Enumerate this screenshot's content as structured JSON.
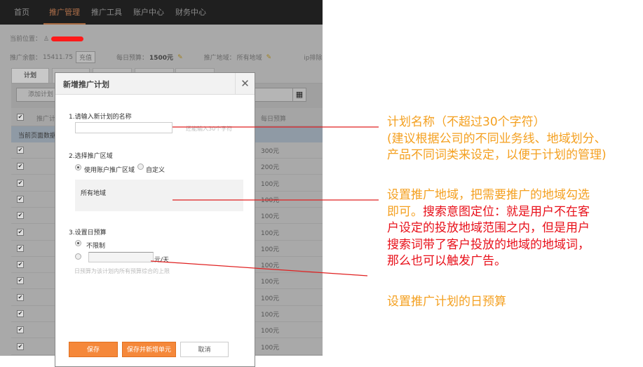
{
  "nav": {
    "items": [
      "首页",
      "推广管理",
      "推广工具",
      "账户中心",
      "财务中心"
    ],
    "active": 1
  },
  "location": {
    "label": "当前位置："
  },
  "summary": {
    "balance_label": "推广余额：",
    "balance": "15411.75",
    "recharge": "充值",
    "daily_label": "每日预算：",
    "daily": "1500元",
    "region_label": "推广地域：",
    "region": "所有地域",
    "ip_exclude": "ip排除"
  },
  "tabs": {
    "first": "计划"
  },
  "toolbar": {
    "add_plan": "添加计划"
  },
  "table": {
    "header_plan": "推广计",
    "header_budget": "每日预算",
    "page_data_label": "当前页面数据",
    "budgets": [
      "300元",
      "200元",
      "100元",
      "100元",
      "100元",
      "100元",
      "100元",
      "100元",
      "100元",
      "100元",
      "100元",
      "100元",
      "100元"
    ]
  },
  "modal": {
    "title": "新增推广计划",
    "step1": "1.请输入新计划的名称",
    "name_value": "",
    "name_hint": "还能输入30个字符",
    "step2": "2.选择推广区域",
    "use_account_region": "使用账户推广区域",
    "custom": "自定义",
    "region_box": "所有地域",
    "step3": "3.设置日预算",
    "unlimited": "不限制",
    "budget_value": "",
    "per_day": "元/天",
    "budget_hint": "日预算为该计划内所有预算综合的上限",
    "save": "保存",
    "save_and_add": "保存并新增单元",
    "cancel": "取消"
  },
  "annotations": {
    "a1": [
      "计划名称（不超过30个字符）",
      "(建议根据公司的不同业务线、地域划分、",
      "产品不同词类来设定，以便于计划的管理)"
    ],
    "a2_orange": [
      "设置推广地域，把需要推广的地域勾选",
      "即可。"
    ],
    "a2_red": [
      "搜索意图定位：就是用户不在客",
      "户设定的投放地域范围之内，但是用户",
      "搜索词带了客户投放的地域的地域词，",
      "那么也可以触发广告。"
    ],
    "a3": "设置推广计划的日预算"
  },
  "colors": {
    "accent": "#f5883a",
    "annotation_orange": "#f4a020",
    "annotation_red": "#e8101a"
  }
}
